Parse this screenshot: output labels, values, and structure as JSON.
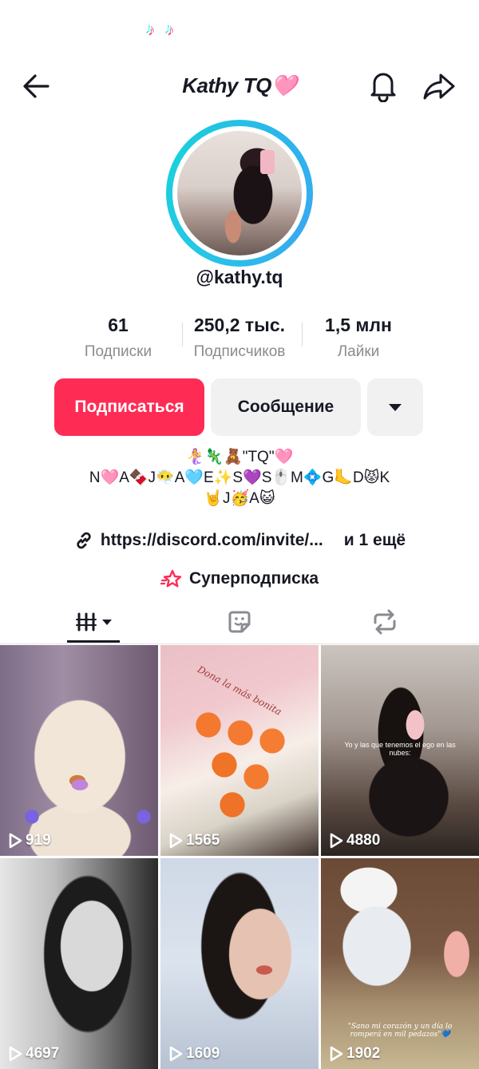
{
  "topbar": {
    "title": "Kathy TQ🩷"
  },
  "profile": {
    "username": "@kathy.tq",
    "stats": [
      {
        "value": "61",
        "label": "Подписки"
      },
      {
        "value": "250,2 тыс.",
        "label": "Подписчиков"
      },
      {
        "value": "1,5 млн",
        "label": "Лайки"
      }
    ],
    "follow_label": "Подписаться",
    "message_label": "Сообщение",
    "bio": [
      "🧜‍♀️🦎🧸\"TQ\"🩷",
      "N🩷A🍫J😶‍🌫️A🩵E✨S💜S🖱️M💠G🦶D😾K",
      "🤘J🥳A😺"
    ],
    "link_text": "https://discord.com/invite/...",
    "link_more": "и 1 ещё",
    "super_label": "Суперподписка"
  },
  "tabs": [
    {
      "icon": "videos-grid-icon"
    },
    {
      "icon": "sticker-icon"
    },
    {
      "icon": "repost-icon"
    }
  ],
  "videos": [
    {
      "views": "919"
    },
    {
      "views": "1565",
      "caption": "Dona la más bonita"
    },
    {
      "views": "4880",
      "caption": "Yo y las que tenemos el ego en las nubes:"
    },
    {
      "views": "4697"
    },
    {
      "views": "1609"
    },
    {
      "views": "1902",
      "caption": "\"Sano mi corazón y un día lo romperá en mil pedazos\"💙"
    }
  ],
  "colors": {
    "accent": "#fe2c55",
    "ring": "#25c6e6",
    "muted": "#8a8b91"
  }
}
